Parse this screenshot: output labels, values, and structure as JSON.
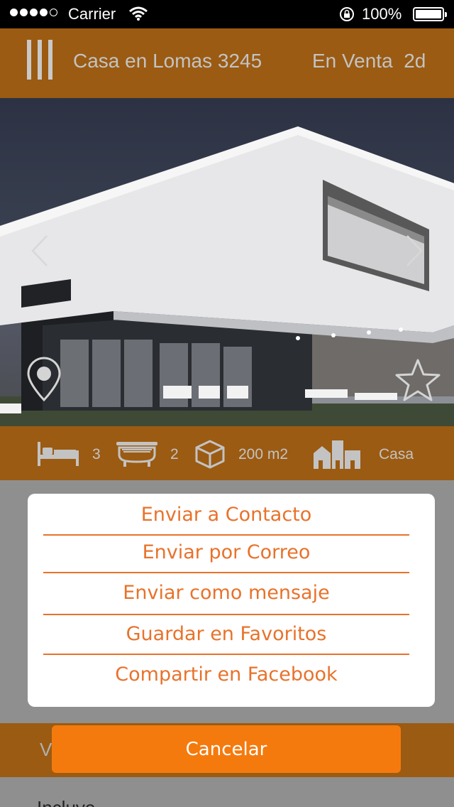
{
  "status_bar": {
    "carrier": "Carrier",
    "battery": "100%",
    "signal_bars_filled": 4,
    "signal_bars_total": 5,
    "icons": [
      "wifi-icon",
      "lock-rotation-icon",
      "battery-icon"
    ]
  },
  "header": {
    "title": "Casa en Lomas 3245",
    "status": "En Venta  2d",
    "menu_icon": "menu-icon"
  },
  "photo": {
    "icons": [
      "arrow-left-icon",
      "arrow-right-icon",
      "location-pin-icon",
      "star-icon"
    ]
  },
  "specs": {
    "bedrooms": "3",
    "bathrooms": "2",
    "area": "200 m2",
    "type": "Casa"
  },
  "content": {
    "section_label_partial": "V",
    "incluye": "Incluye"
  },
  "action_sheet": {
    "items": [
      "Enviar a Contacto",
      "Enviar por Correo",
      "Enviar como mensaje",
      "Guardar en Favoritos",
      "Compartir en Facebook"
    ],
    "cancel_label": "Cancelar"
  },
  "colors": {
    "accent": "#f57a0d",
    "header_bg": "#9b5b12",
    "action_text": "#e8722b",
    "overlay": "#8f8f8f"
  }
}
